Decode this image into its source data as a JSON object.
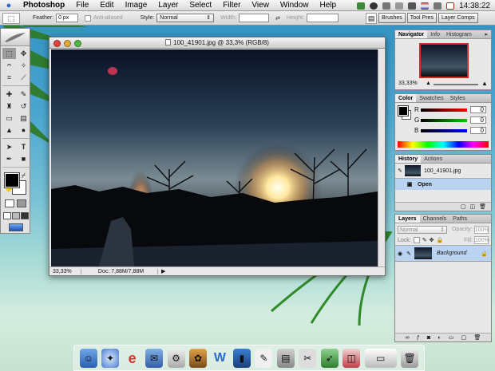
{
  "menubar": {
    "app_name": "Photoshop",
    "items": [
      "File",
      "Edit",
      "Image",
      "Layer",
      "Select",
      "Filter",
      "View",
      "Window",
      "Help"
    ],
    "clock": "14:38:22"
  },
  "options_bar": {
    "feather_label": "Feather:",
    "feather_value": "0 px",
    "anti_aliased_label": "Anti-aliased",
    "style_label": "Style:",
    "style_value": "Normal",
    "width_label": "Width:",
    "height_label": "Height:",
    "palette_tabs": [
      "Brushes",
      "Tool Pres",
      "Layer Comps"
    ]
  },
  "document": {
    "title": "100_41901.jpg @ 33,3% (RGB/8)",
    "zoom": "33,33%",
    "doc_info": "Doc: 7,88M/7,88M"
  },
  "navigator_palette": {
    "tabs": [
      "Navigator",
      "Info",
      "Histogram"
    ],
    "active_tab": "Navigator",
    "zoom": "33,33%"
  },
  "color_palette": {
    "tabs": [
      "Color",
      "Swatches",
      "Styles"
    ],
    "active_tab": "Color",
    "channels": [
      {
        "label": "R",
        "value": "0"
      },
      {
        "label": "G",
        "value": "0"
      },
      {
        "label": "B",
        "value": "0"
      }
    ]
  },
  "history_palette": {
    "tabs": [
      "History",
      "Actions"
    ],
    "active_tab": "History",
    "snapshot": "100_41901.jpg",
    "states": [
      "Open"
    ]
  },
  "layers_palette": {
    "tabs": [
      "Layers",
      "Channels",
      "Paths"
    ],
    "active_tab": "Layers",
    "blend_mode": "Normal",
    "opacity_label": "Opacity:",
    "opacity_value": "100%",
    "lock_label": "Lock:",
    "fill_label": "Fill:",
    "fill_value": "100%",
    "layers": [
      "Background"
    ]
  },
  "colors": {
    "selection": "#b9d3f0",
    "navigator_box": "#d9262b"
  }
}
